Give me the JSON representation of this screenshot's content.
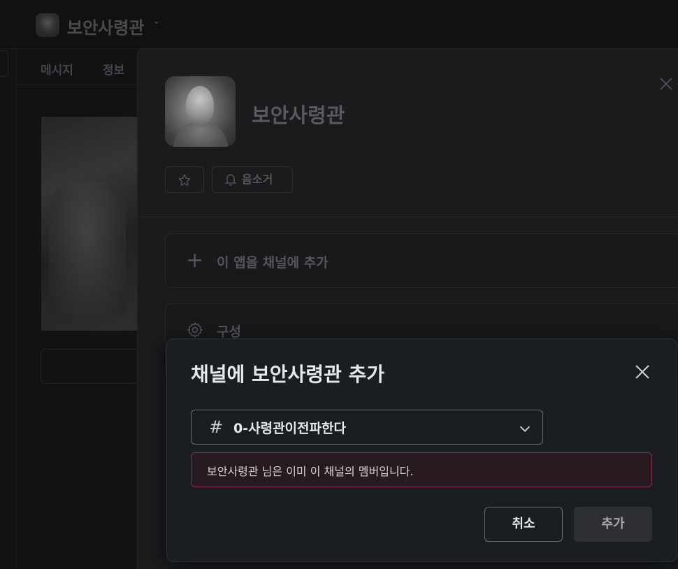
{
  "background": {
    "app_name": "보안사령관",
    "tabs": [
      {
        "label": "메시지"
      },
      {
        "label": "정보"
      }
    ]
  },
  "panel": {
    "title": "보안사령관",
    "mute_label": "음소거",
    "add_to_channel_label": "이 앱을 채널에 추가",
    "configuration_label": "구성"
  },
  "modal": {
    "title": "채널에 보안사령관 추가",
    "channel_select": {
      "value": "0-사령관이전파한다"
    },
    "error_message": "보안사령관 님은 이미 이 채널의 멤버입니다.",
    "cancel_label": "취소",
    "add_label": "추가"
  },
  "icons": {
    "modal_close": "close-icon",
    "panel_close": "close-icon",
    "star": "star-icon",
    "bell": "bell-icon",
    "plus": "plus-icon",
    "gear": "gear-icon",
    "hash": "hash-icon",
    "chevron": "chevron-down-icon"
  },
  "colors": {
    "modal_bg": "#1a1d21",
    "error_border": "#8e2a4a",
    "error_bg": "#271a21",
    "disabled_button_bg": "#2d2f33"
  }
}
